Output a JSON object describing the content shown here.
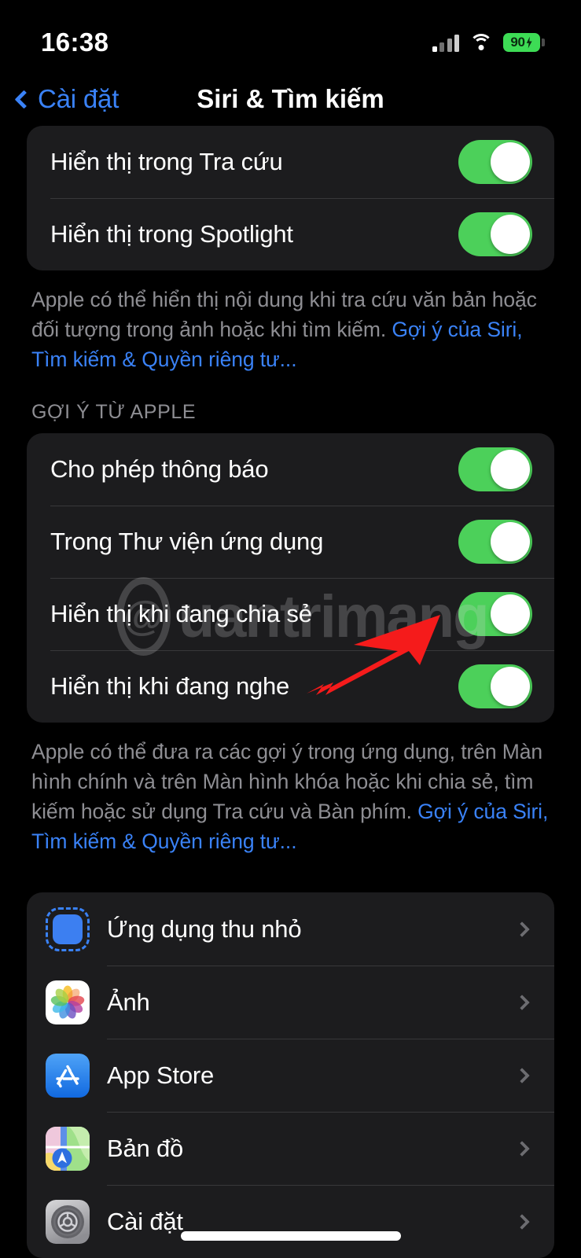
{
  "status_bar": {
    "time": "16:38",
    "battery_percent": "90",
    "battery_charging": true,
    "wifi_icon": "wifi-icon",
    "signal_icon": "cellular-signal-icon"
  },
  "nav": {
    "back_label": "Cài đặt",
    "back_icon": "chevron-left-icon",
    "title": "Siri & Tìm kiếm"
  },
  "colors": {
    "accent_blue": "#3A82F7",
    "toggle_green": "#4CD05A",
    "row_background": "#1C1C1E",
    "secondary_text": "#8E8E93",
    "arrow_red": "#F51B1B"
  },
  "top_group": {
    "rows": [
      {
        "label": "Hiển thị trong Tra cứu",
        "toggle": "on"
      },
      {
        "label": "Hiển thị trong Spotlight",
        "toggle": "on"
      }
    ],
    "footer_text": "Apple có thể hiển thị nội dung khi tra cứu văn bản hoặc đối tượng trong ảnh hoặc khi tìm kiếm. ",
    "footer_link": "Gợi ý của Siri, Tìm kiếm & Quyền riêng tư..."
  },
  "suggestions_section": {
    "header": "GỢI Ý TỪ APPLE",
    "rows": [
      {
        "label": "Cho phép thông báo",
        "toggle": "on"
      },
      {
        "label": "Trong Thư viện ứng dụng",
        "toggle": "on"
      },
      {
        "label": "Hiển thị khi đang chia sẻ",
        "toggle": "on"
      },
      {
        "label": "Hiển thị khi đang nghe",
        "toggle": "on"
      }
    ],
    "footer_text": "Apple có thể đưa ra các gợi ý trong ứng dụng, trên Màn hình chính và trên Màn hình khóa hoặc khi chia sẻ, tìm kiếm hoặc sử dụng Tra cứu và Bàn phím. ",
    "footer_link": "Gợi ý của Siri, Tìm kiếm & Quyền riêng tư..."
  },
  "app_list": {
    "rows": [
      {
        "label": "Ứng dụng thu nhỏ",
        "icon": "app-clips-icon"
      },
      {
        "label": "Ảnh",
        "icon": "photos-icon"
      },
      {
        "label": "App Store",
        "icon": "app-store-icon"
      },
      {
        "label": "Bản đồ",
        "icon": "maps-icon"
      },
      {
        "label": "Cài đặt",
        "icon": "settings-gear-icon"
      }
    ],
    "disclosure_icon": "chevron-right-icon"
  },
  "watermark": {
    "badge": "@",
    "text": "uantrimang"
  },
  "annotation": {
    "arrow": "red-arrow-pointing-to-sharing-toggle"
  }
}
